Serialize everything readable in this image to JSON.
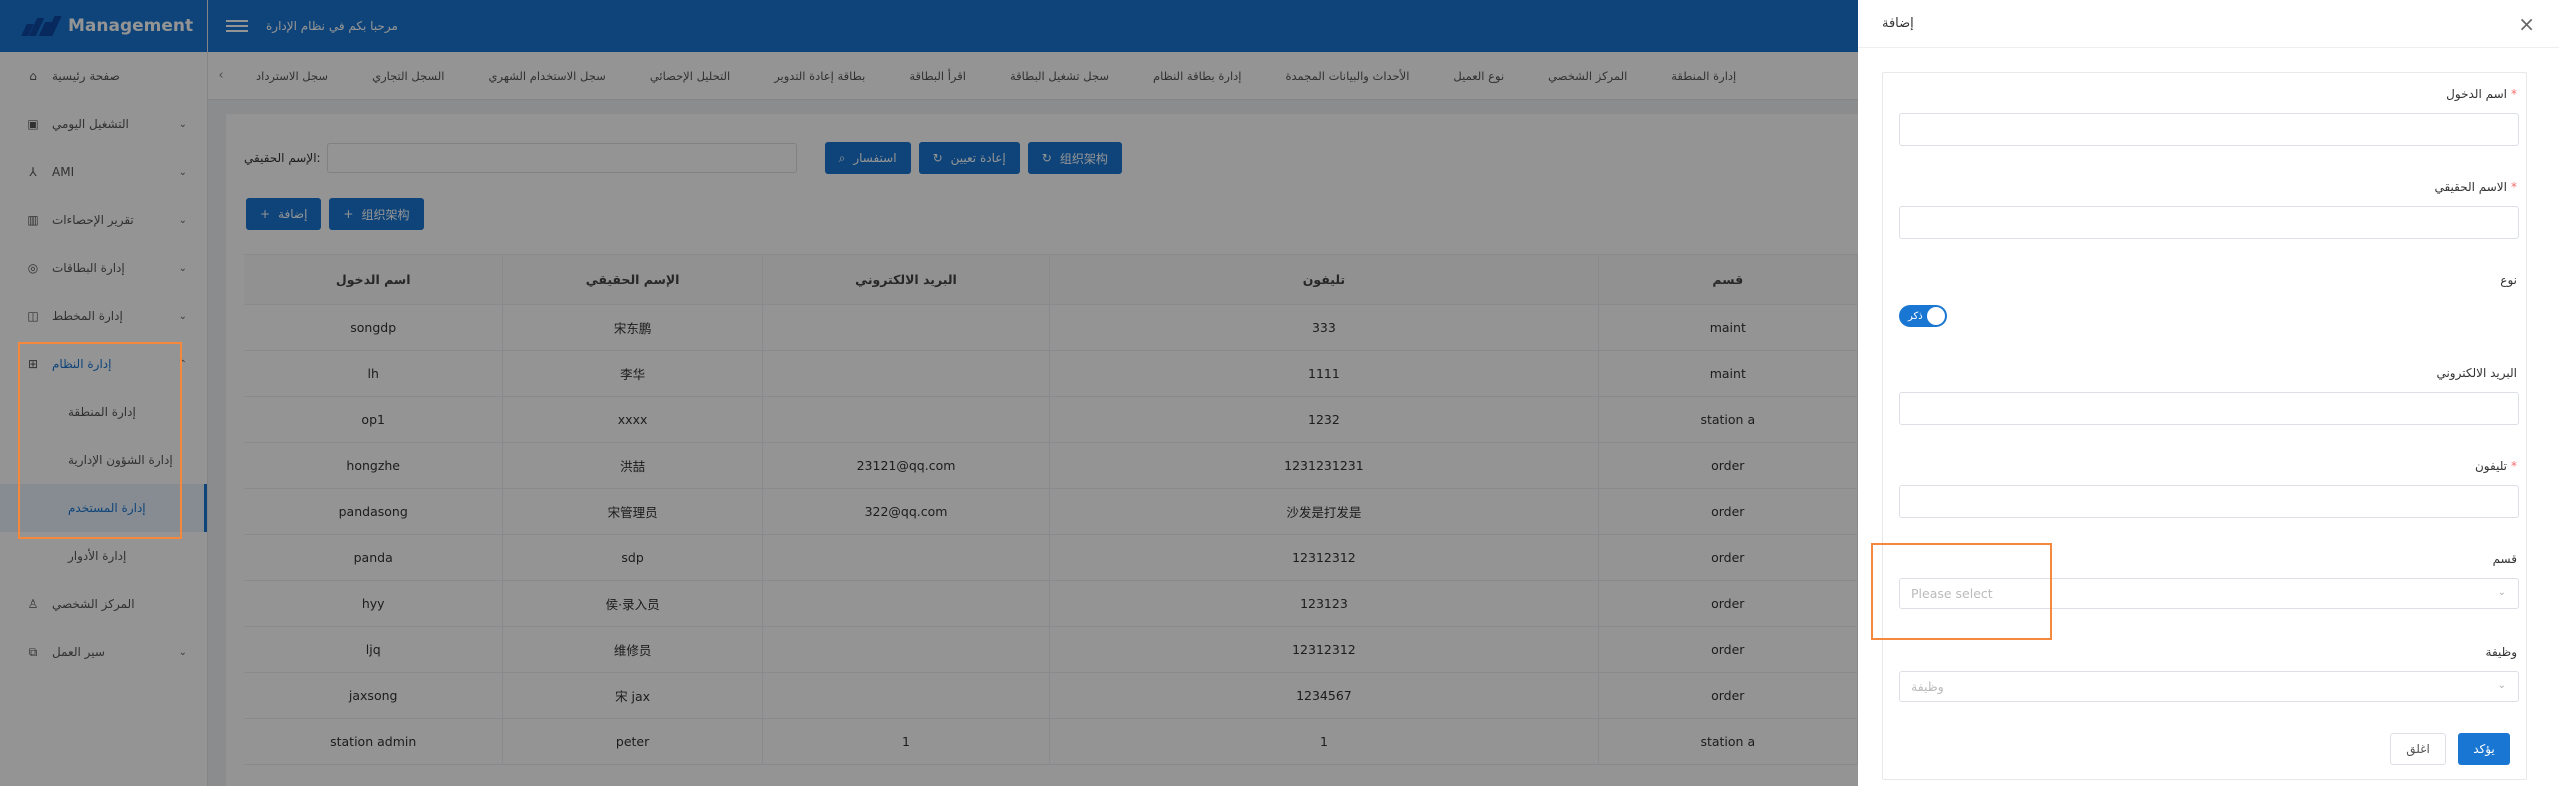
{
  "app": {
    "title": "Management",
    "welcome": "مرحبا بكم في نظام الإدارة"
  },
  "sidebar": {
    "items": [
      {
        "label": "صفحة رئيسية",
        "icon": "home-icon"
      },
      {
        "label": "التشغيل اليومي",
        "icon": "calendar-icon"
      },
      {
        "label": "AMI",
        "icon": "network-icon"
      },
      {
        "label": "تقرير الإحصاءات",
        "icon": "bar-chart-icon"
      },
      {
        "label": "إدارة البطاقات",
        "icon": "card-icon"
      },
      {
        "label": "إدارة المخطط",
        "icon": "lock-icon"
      },
      {
        "label": "إدارة النظام",
        "icon": "grid-icon"
      }
    ],
    "submenu": [
      {
        "label": "إدارة المنطقة"
      },
      {
        "label": "إدارة الشؤون الإدارية"
      },
      {
        "label": "إدارة المستخدم"
      },
      {
        "label": "إدارة الأدوار"
      }
    ],
    "bottom": [
      {
        "label": "المركز الشخصي",
        "icon": "user-icon"
      },
      {
        "label": "سير العمل",
        "icon": "workflow-icon"
      }
    ]
  },
  "tabs": [
    "إدارة المنطقة",
    "المركز الشخصي",
    "نوع العميل",
    "الأحداث والبيانات المجمدة",
    "إدارة بطاقة النظام",
    "سجل تشغيل البطاقة",
    "اقرأ البطاقة",
    "بطاقة إعادة التدوير",
    "التحليل الإحصائي",
    "سجل الاستخدام الشهري",
    "السجل التجاري",
    "سجل الاسترداد"
  ],
  "search": {
    "label": "الإسم الحقيقي:",
    "search_btn": "استفسار",
    "reset_btn": "إعادة تعيين",
    "org_btn": "组织架构"
  },
  "actions": {
    "add": "إضافة",
    "org": "组织架构"
  },
  "table": {
    "headers": [
      "اسم الدخول",
      "الإسم الحقيقي",
      "البريد الالكتروني",
      "تليفون",
      "قسم"
    ],
    "rows": [
      [
        "songdp",
        "宋东鹏",
        "",
        "333",
        "maint"
      ],
      [
        "lh",
        "李华",
        "",
        "1111",
        "maint"
      ],
      [
        "op1",
        "xxxx",
        "",
        "1232",
        "station a"
      ],
      [
        "hongzhe",
        "洪喆",
        "23121@qq.com",
        "1231231231",
        "order"
      ],
      [
        "pandasong",
        "宋管理员",
        "322@qq.com",
        "沙发是打发是",
        "order"
      ],
      [
        "panda",
        "sdp",
        "",
        "12312312",
        "order"
      ],
      [
        "hyy",
        "侯·录入员",
        "",
        "123123",
        "order"
      ],
      [
        "ljq",
        "维修员",
        "",
        "12312312",
        "order"
      ],
      [
        "jaxsong",
        "宋 jax",
        "",
        "1234567",
        "order"
      ],
      [
        "station admin",
        "peter",
        "1",
        "1",
        "station a"
      ]
    ]
  },
  "drawer": {
    "title": "إضافة",
    "fields": {
      "login_name": "اسم الدخول",
      "real_name": "الاسم الحقيقي",
      "gender": "نوع",
      "gender_value": "ذكر",
      "email": "البريد الالكتروني",
      "phone": "تليفون",
      "department": "قسم",
      "department_placeholder": "Please select",
      "job": "وظيفة",
      "job_placeholder": "وظيفة"
    },
    "cancel": "اغلق",
    "confirm": "يؤكد"
  },
  "colors": {
    "primary": "#1976d2",
    "highlight": "#f5883c",
    "required": "#f56c6c"
  }
}
